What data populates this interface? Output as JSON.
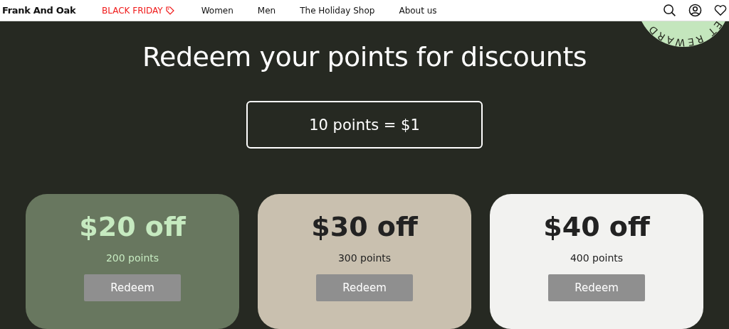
{
  "header": {
    "logo": "Frank And Oak",
    "nav": [
      {
        "label": "BLACK FRIDAY",
        "kind": "sale"
      },
      {
        "label": "Women",
        "kind": "plain"
      },
      {
        "label": "Men",
        "kind": "plain"
      },
      {
        "label": "The Holiday Shop",
        "kind": "plain"
      },
      {
        "label": "About us",
        "kind": "plain"
      }
    ]
  },
  "badge": {
    "text": "ET REWARD"
  },
  "title": "Redeem your points for discounts",
  "rate": "10 points = $1",
  "rewards": [
    {
      "amount": "$20 off",
      "points": "200 points",
      "button": "Redeem",
      "kind": "green"
    },
    {
      "amount": "$30 off",
      "points": "300 points",
      "button": "Redeem",
      "kind": "beige"
    },
    {
      "amount": "$40 off",
      "points": "400 points",
      "button": "Redeem",
      "kind": "light"
    }
  ]
}
